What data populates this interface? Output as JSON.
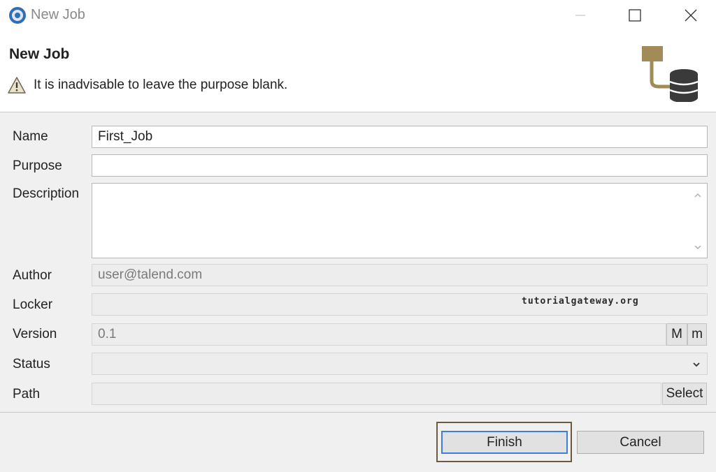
{
  "window": {
    "title": "New Job",
    "app_icon": "talend-studio-icon",
    "controls": [
      "minimize-icon",
      "maximize-icon",
      "close-icon"
    ]
  },
  "header": {
    "title": "New Job",
    "message": "It is inadvisable to leave the purpose blank.",
    "message_icon": "warning-icon",
    "banner_icon": "job-database-icon"
  },
  "form": {
    "name": {
      "label": "Name",
      "value": "First_Job"
    },
    "purpose": {
      "label": "Purpose",
      "value": ""
    },
    "description": {
      "label": "Description",
      "value": ""
    },
    "author": {
      "label": "Author",
      "value": "user@talend.com"
    },
    "locker": {
      "label": "Locker",
      "value": ""
    },
    "version": {
      "label": "Version",
      "value": "0.1",
      "major_button": "M",
      "minor_button": "m"
    },
    "status": {
      "label": "Status",
      "value": ""
    },
    "path": {
      "label": "Path",
      "value": "",
      "select_button": "Select"
    }
  },
  "watermark": "tutorialgateway.org",
  "buttons": {
    "finish": "Finish",
    "cancel": "Cancel"
  },
  "colors": {
    "form_background": "#f0f0f0",
    "focus_border": "#3d7fd0",
    "banner_brown": "#a38b57",
    "banner_dark": "#3a3a3a"
  }
}
